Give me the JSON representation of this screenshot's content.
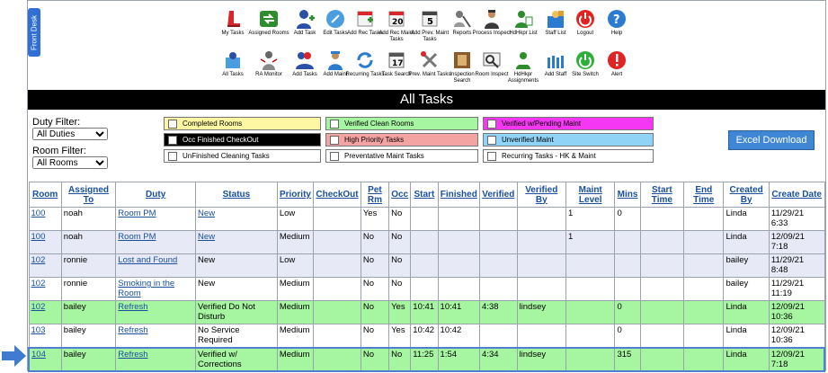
{
  "front_desk_tab": "Front Desk",
  "toolbar_row1": [
    {
      "label": "My Tasks",
      "icon": "my-tasks-icon"
    },
    {
      "label": "Assigned Rooms",
      "icon": "assigned-rooms-icon"
    },
    {
      "label": "Add Task",
      "icon": "add-task-icon"
    },
    {
      "label": "Edit Tasks",
      "icon": "edit-tasks-icon"
    },
    {
      "label": "Add Rec Tasks",
      "icon": "add-rec-tasks-icon"
    },
    {
      "label": "Add Rec Maint Tasks",
      "icon": "add-rec-maint-tasks-icon"
    },
    {
      "label": "Add Prev. Maint Tasks",
      "icon": "add-prev-maint-tasks-icon"
    },
    {
      "label": "Reports",
      "icon": "reports-icon"
    },
    {
      "label": "Process Inspect",
      "icon": "process-inspect-icon"
    },
    {
      "label": "HdHkpr List",
      "icon": "hdhkpr-list-icon"
    },
    {
      "label": "Staff List",
      "icon": "staff-list-icon"
    },
    {
      "label": "Logout",
      "icon": "logout-icon"
    },
    {
      "label": "Help",
      "icon": "help-icon"
    }
  ],
  "toolbar_row2": [
    {
      "label": "All Tasks",
      "icon": "all-tasks-icon"
    },
    {
      "label": "RA Monitor",
      "icon": "ra-monitor-icon"
    },
    {
      "label": "Add Tasks",
      "icon": "add-tasks-icon"
    },
    {
      "label": "Add Maint",
      "icon": "add-maint-icon"
    },
    {
      "label": "Recurring Tasks",
      "icon": "recurring-tasks-icon"
    },
    {
      "label": "Task Search",
      "icon": "task-search-icon"
    },
    {
      "label": "Prev. Maint Tasks",
      "icon": "prev-maint-tasks-icon"
    },
    {
      "label": "Inspection Search",
      "icon": "inspection-search-icon"
    },
    {
      "label": "Room Inspect",
      "icon": "room-inspect-icon"
    },
    {
      "label": "HdHkpr Assignments",
      "icon": "hdhkpr-assignments-icon"
    },
    {
      "label": "Add Staff",
      "icon": "add-staff-icon"
    },
    {
      "label": "Site Switch",
      "icon": "site-switch-icon"
    },
    {
      "label": "Alert",
      "icon": "alert-icon"
    }
  ],
  "page_title": "All Tasks",
  "filters": {
    "duty_label": "Duty Filter:",
    "duty_value": "All Duties",
    "room_label": "Room Filter:",
    "room_value": "All Rooms"
  },
  "legend": {
    "completed": "Completed Rooms",
    "occ_finished": "Occ Finished CheckOut",
    "unfinished": "UnFinished Cleaning Tasks",
    "verified_clean": "Verified Clean Rooms",
    "high_priority": "High Priority Tasks",
    "preventative": "Preventative Maint Tasks",
    "verified_pending": "Verified w/Pending Maint",
    "unverified": "Unverified Maint",
    "recurring": "Recurring Tasks - HK & Maint"
  },
  "colors": {
    "completed": "#fdf7a3",
    "occ_finished": "#000000",
    "unfinished": "#ffffff",
    "verified_clean": "#a6f5a0",
    "high_priority": "#f4a3a3",
    "preventative": "#ffffff",
    "verified_pending": "#f536f2",
    "unverified": "#8fd3f7",
    "recurring": "#ffffff"
  },
  "excel_button": "Excel Download",
  "table": {
    "headers": [
      "Room",
      "Assigned To",
      "Duty",
      "Status",
      "Priority",
      "CheckOut",
      "Pet Rm",
      "Occ",
      "Start",
      "Finished",
      "Verified",
      "Verified By",
      "Maint Level",
      "Mins",
      "Start Time",
      "End Time",
      "Created By",
      "Create Date"
    ],
    "rows": [
      {
        "style": "white",
        "cells": [
          "100",
          "noah",
          "Room PM",
          "New",
          "Low",
          "",
          "Yes",
          "No",
          "",
          "",
          "",
          "",
          "1",
          "0",
          "",
          "",
          "Linda",
          "11/29/21 6:33"
        ]
      },
      {
        "style": "lavender",
        "cells": [
          "100",
          "noah",
          "Room PM",
          "New",
          "Medium",
          "",
          "No",
          "No",
          "",
          "",
          "",
          "",
          "1",
          "",
          "",
          "",
          "Linda",
          "12/09/21 7:18"
        ]
      },
      {
        "style": "lavender",
        "cells": [
          "102",
          "ronnie",
          "Lost and Found",
          "New",
          "Low",
          "",
          "No",
          "No",
          "",
          "",
          "",
          "",
          "",
          "",
          "",
          "",
          "bailey",
          "11/29/21 8:48"
        ]
      },
      {
        "style": "white",
        "cells": [
          "102",
          "ronnie",
          "Smoking in the Room",
          "New",
          "Medium",
          "",
          "No",
          "No",
          "",
          "",
          "",
          "",
          "",
          "",
          "",
          "",
          "bailey",
          "11/29/21 11:19"
        ]
      },
      {
        "style": "green",
        "cells": [
          "102",
          "bailey",
          "Refresh",
          "Verified Do Not Disturb",
          "Medium",
          "",
          "No",
          "Yes",
          "10:41",
          "10:41",
          "4:38",
          "lindsey",
          "",
          "0",
          "",
          "",
          "Linda",
          "12/09/21 10:36"
        ]
      },
      {
        "style": "white",
        "cells": [
          "103",
          "bailey",
          "Refresh",
          "No Service Required",
          "Medium",
          "",
          "No",
          "Yes",
          "10:42",
          "10:42",
          "",
          "",
          "",
          "0",
          "",
          "",
          "Linda",
          "12/09/21 10:36"
        ]
      },
      {
        "style": "green selected",
        "cells": [
          "104",
          "bailey",
          "Refresh",
          "Verified w/ Corrections",
          "Medium",
          "",
          "No",
          "No",
          "11:25",
          "1:54",
          "4:34",
          "lindsey",
          "",
          "315",
          "",
          "",
          "Linda",
          "12/09/21 7:18"
        ]
      }
    ]
  }
}
